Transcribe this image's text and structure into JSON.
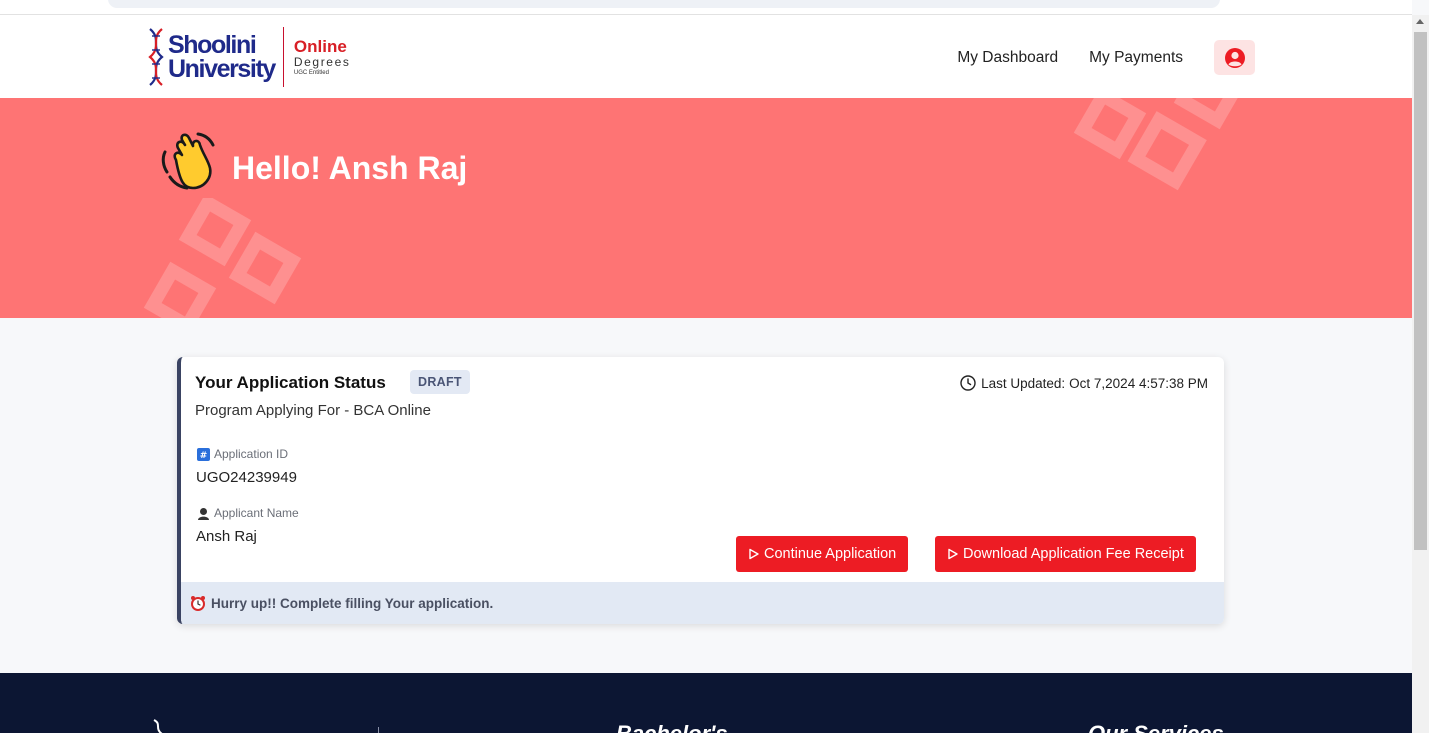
{
  "brand": {
    "university_line1": "Shoolini",
    "university_line2": "University",
    "online": "Online",
    "degrees": "Degrees",
    "ugc": "UGC Entitled"
  },
  "nav": {
    "dashboard": "My Dashboard",
    "payments": "My Payments",
    "profile_icon": "user-circle-icon"
  },
  "hero": {
    "greeting": "Hello! Ansh Raj",
    "wave_icon": "waving-hand-icon"
  },
  "application": {
    "title": "Your Application Status",
    "status": "DRAFT",
    "last_updated_label": "Last Updated:",
    "last_updated_value": "Oct 7,2024 4:57:38 PM",
    "program": "Program Applying For - BCA Online",
    "id_label": "Application ID",
    "id_value": "UGO24239949",
    "name_label": "Applicant Name",
    "name_value": "Ansh Raj",
    "continue_button": "Continue Application",
    "receipt_button": "Download Application Fee Receipt",
    "note": "Hurry up!! Complete filling Your application."
  },
  "footer": {
    "col2_heading": "Bachelor's",
    "col3_heading": "Our Services"
  },
  "colors": {
    "hero_bg": "#fe7474",
    "accent_red": "#ed1c24",
    "footer_bg": "#0c1633",
    "brand_blue": "#1f2a8a"
  }
}
